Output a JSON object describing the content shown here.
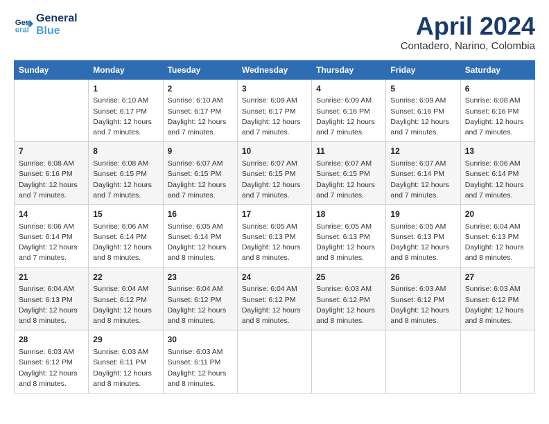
{
  "logo": {
    "line1": "General",
    "line2": "Blue"
  },
  "title": "April 2024",
  "subtitle": "Contadero, Narino, Colombia",
  "header": {
    "days": [
      "Sunday",
      "Monday",
      "Tuesday",
      "Wednesday",
      "Thursday",
      "Friday",
      "Saturday"
    ]
  },
  "weeks": [
    [
      {
        "day": "",
        "info": ""
      },
      {
        "day": "1",
        "info": "Sunrise: 6:10 AM\nSunset: 6:17 PM\nDaylight: 12 hours\nand 7 minutes."
      },
      {
        "day": "2",
        "info": "Sunrise: 6:10 AM\nSunset: 6:17 PM\nDaylight: 12 hours\nand 7 minutes."
      },
      {
        "day": "3",
        "info": "Sunrise: 6:09 AM\nSunset: 6:17 PM\nDaylight: 12 hours\nand 7 minutes."
      },
      {
        "day": "4",
        "info": "Sunrise: 6:09 AM\nSunset: 6:16 PM\nDaylight: 12 hours\nand 7 minutes."
      },
      {
        "day": "5",
        "info": "Sunrise: 6:09 AM\nSunset: 6:16 PM\nDaylight: 12 hours\nand 7 minutes."
      },
      {
        "day": "6",
        "info": "Sunrise: 6:08 AM\nSunset: 6:16 PM\nDaylight: 12 hours\nand 7 minutes."
      }
    ],
    [
      {
        "day": "7",
        "info": "Sunrise: 6:08 AM\nSunset: 6:16 PM\nDaylight: 12 hours\nand 7 minutes."
      },
      {
        "day": "8",
        "info": "Sunrise: 6:08 AM\nSunset: 6:15 PM\nDaylight: 12 hours\nand 7 minutes."
      },
      {
        "day": "9",
        "info": "Sunrise: 6:07 AM\nSunset: 6:15 PM\nDaylight: 12 hours\nand 7 minutes."
      },
      {
        "day": "10",
        "info": "Sunrise: 6:07 AM\nSunset: 6:15 PM\nDaylight: 12 hours\nand 7 minutes."
      },
      {
        "day": "11",
        "info": "Sunrise: 6:07 AM\nSunset: 6:15 PM\nDaylight: 12 hours\nand 7 minutes."
      },
      {
        "day": "12",
        "info": "Sunrise: 6:07 AM\nSunset: 6:14 PM\nDaylight: 12 hours\nand 7 minutes."
      },
      {
        "day": "13",
        "info": "Sunrise: 6:06 AM\nSunset: 6:14 PM\nDaylight: 12 hours\nand 7 minutes."
      }
    ],
    [
      {
        "day": "14",
        "info": "Sunrise: 6:06 AM\nSunset: 6:14 PM\nDaylight: 12 hours\nand 7 minutes."
      },
      {
        "day": "15",
        "info": "Sunrise: 6:06 AM\nSunset: 6:14 PM\nDaylight: 12 hours\nand 8 minutes."
      },
      {
        "day": "16",
        "info": "Sunrise: 6:05 AM\nSunset: 6:14 PM\nDaylight: 12 hours\nand 8 minutes."
      },
      {
        "day": "17",
        "info": "Sunrise: 6:05 AM\nSunset: 6:13 PM\nDaylight: 12 hours\nand 8 minutes."
      },
      {
        "day": "18",
        "info": "Sunrise: 6:05 AM\nSunset: 6:13 PM\nDaylight: 12 hours\nand 8 minutes."
      },
      {
        "day": "19",
        "info": "Sunrise: 6:05 AM\nSunset: 6:13 PM\nDaylight: 12 hours\nand 8 minutes."
      },
      {
        "day": "20",
        "info": "Sunrise: 6:04 AM\nSunset: 6:13 PM\nDaylight: 12 hours\nand 8 minutes."
      }
    ],
    [
      {
        "day": "21",
        "info": "Sunrise: 6:04 AM\nSunset: 6:13 PM\nDaylight: 12 hours\nand 8 minutes."
      },
      {
        "day": "22",
        "info": "Sunrise: 6:04 AM\nSunset: 6:12 PM\nDaylight: 12 hours\nand 8 minutes."
      },
      {
        "day": "23",
        "info": "Sunrise: 6:04 AM\nSunset: 6:12 PM\nDaylight: 12 hours\nand 8 minutes."
      },
      {
        "day": "24",
        "info": "Sunrise: 6:04 AM\nSunset: 6:12 PM\nDaylight: 12 hours\nand 8 minutes."
      },
      {
        "day": "25",
        "info": "Sunrise: 6:03 AM\nSunset: 6:12 PM\nDaylight: 12 hours\nand 8 minutes."
      },
      {
        "day": "26",
        "info": "Sunrise: 6:03 AM\nSunset: 6:12 PM\nDaylight: 12 hours\nand 8 minutes."
      },
      {
        "day": "27",
        "info": "Sunrise: 6:03 AM\nSunset: 6:12 PM\nDaylight: 12 hours\nand 8 minutes."
      }
    ],
    [
      {
        "day": "28",
        "info": "Sunrise: 6:03 AM\nSunset: 6:12 PM\nDaylight: 12 hours\nand 8 minutes."
      },
      {
        "day": "29",
        "info": "Sunrise: 6:03 AM\nSunset: 6:11 PM\nDaylight: 12 hours\nand 8 minutes."
      },
      {
        "day": "30",
        "info": "Sunrise: 6:03 AM\nSunset: 6:11 PM\nDaylight: 12 hours\nand 8 minutes."
      },
      {
        "day": "",
        "info": ""
      },
      {
        "day": "",
        "info": ""
      },
      {
        "day": "",
        "info": ""
      },
      {
        "day": "",
        "info": ""
      }
    ]
  ]
}
